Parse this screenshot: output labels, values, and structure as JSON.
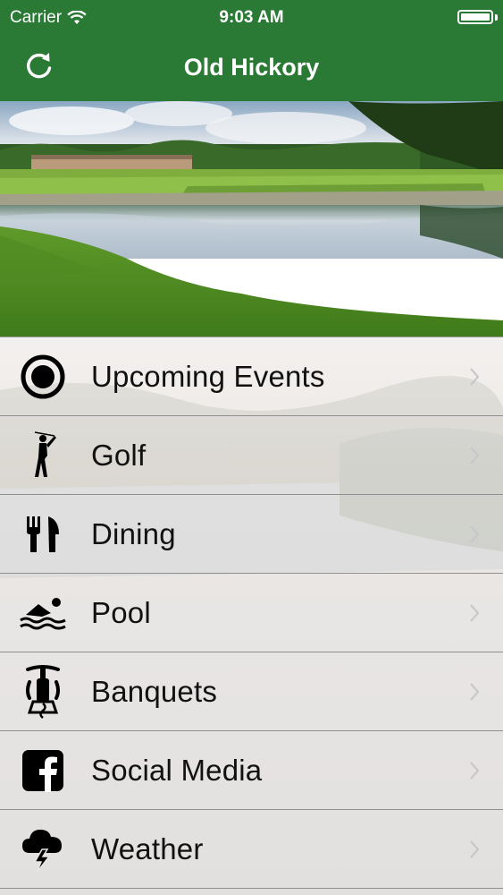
{
  "status_bar": {
    "carrier": "Carrier",
    "time": "9:03 AM",
    "battery_level": 1.0
  },
  "nav_bar": {
    "title": "Old Hickory",
    "refresh_icon": "refresh-icon"
  },
  "colors": {
    "header_green": "#2a7a36",
    "text": "#111111",
    "chevron": "#c7c7cc"
  },
  "menu": {
    "items": [
      {
        "label": "Upcoming Events",
        "icon": "target-circle-icon",
        "chevron": true
      },
      {
        "label": "Golf",
        "icon": "golfer-icon",
        "chevron": true
      },
      {
        "label": "Dining",
        "icon": "fork-knife-icon",
        "chevron": true
      },
      {
        "label": "Pool",
        "icon": "swimmer-icon",
        "chevron": true
      },
      {
        "label": "Banquets",
        "icon": "corkscrew-icon",
        "chevron": true
      },
      {
        "label": "Social Media",
        "icon": "facebook-icon",
        "chevron": true
      },
      {
        "label": "Weather",
        "icon": "storm-cloud-icon",
        "chevron": true
      }
    ]
  }
}
